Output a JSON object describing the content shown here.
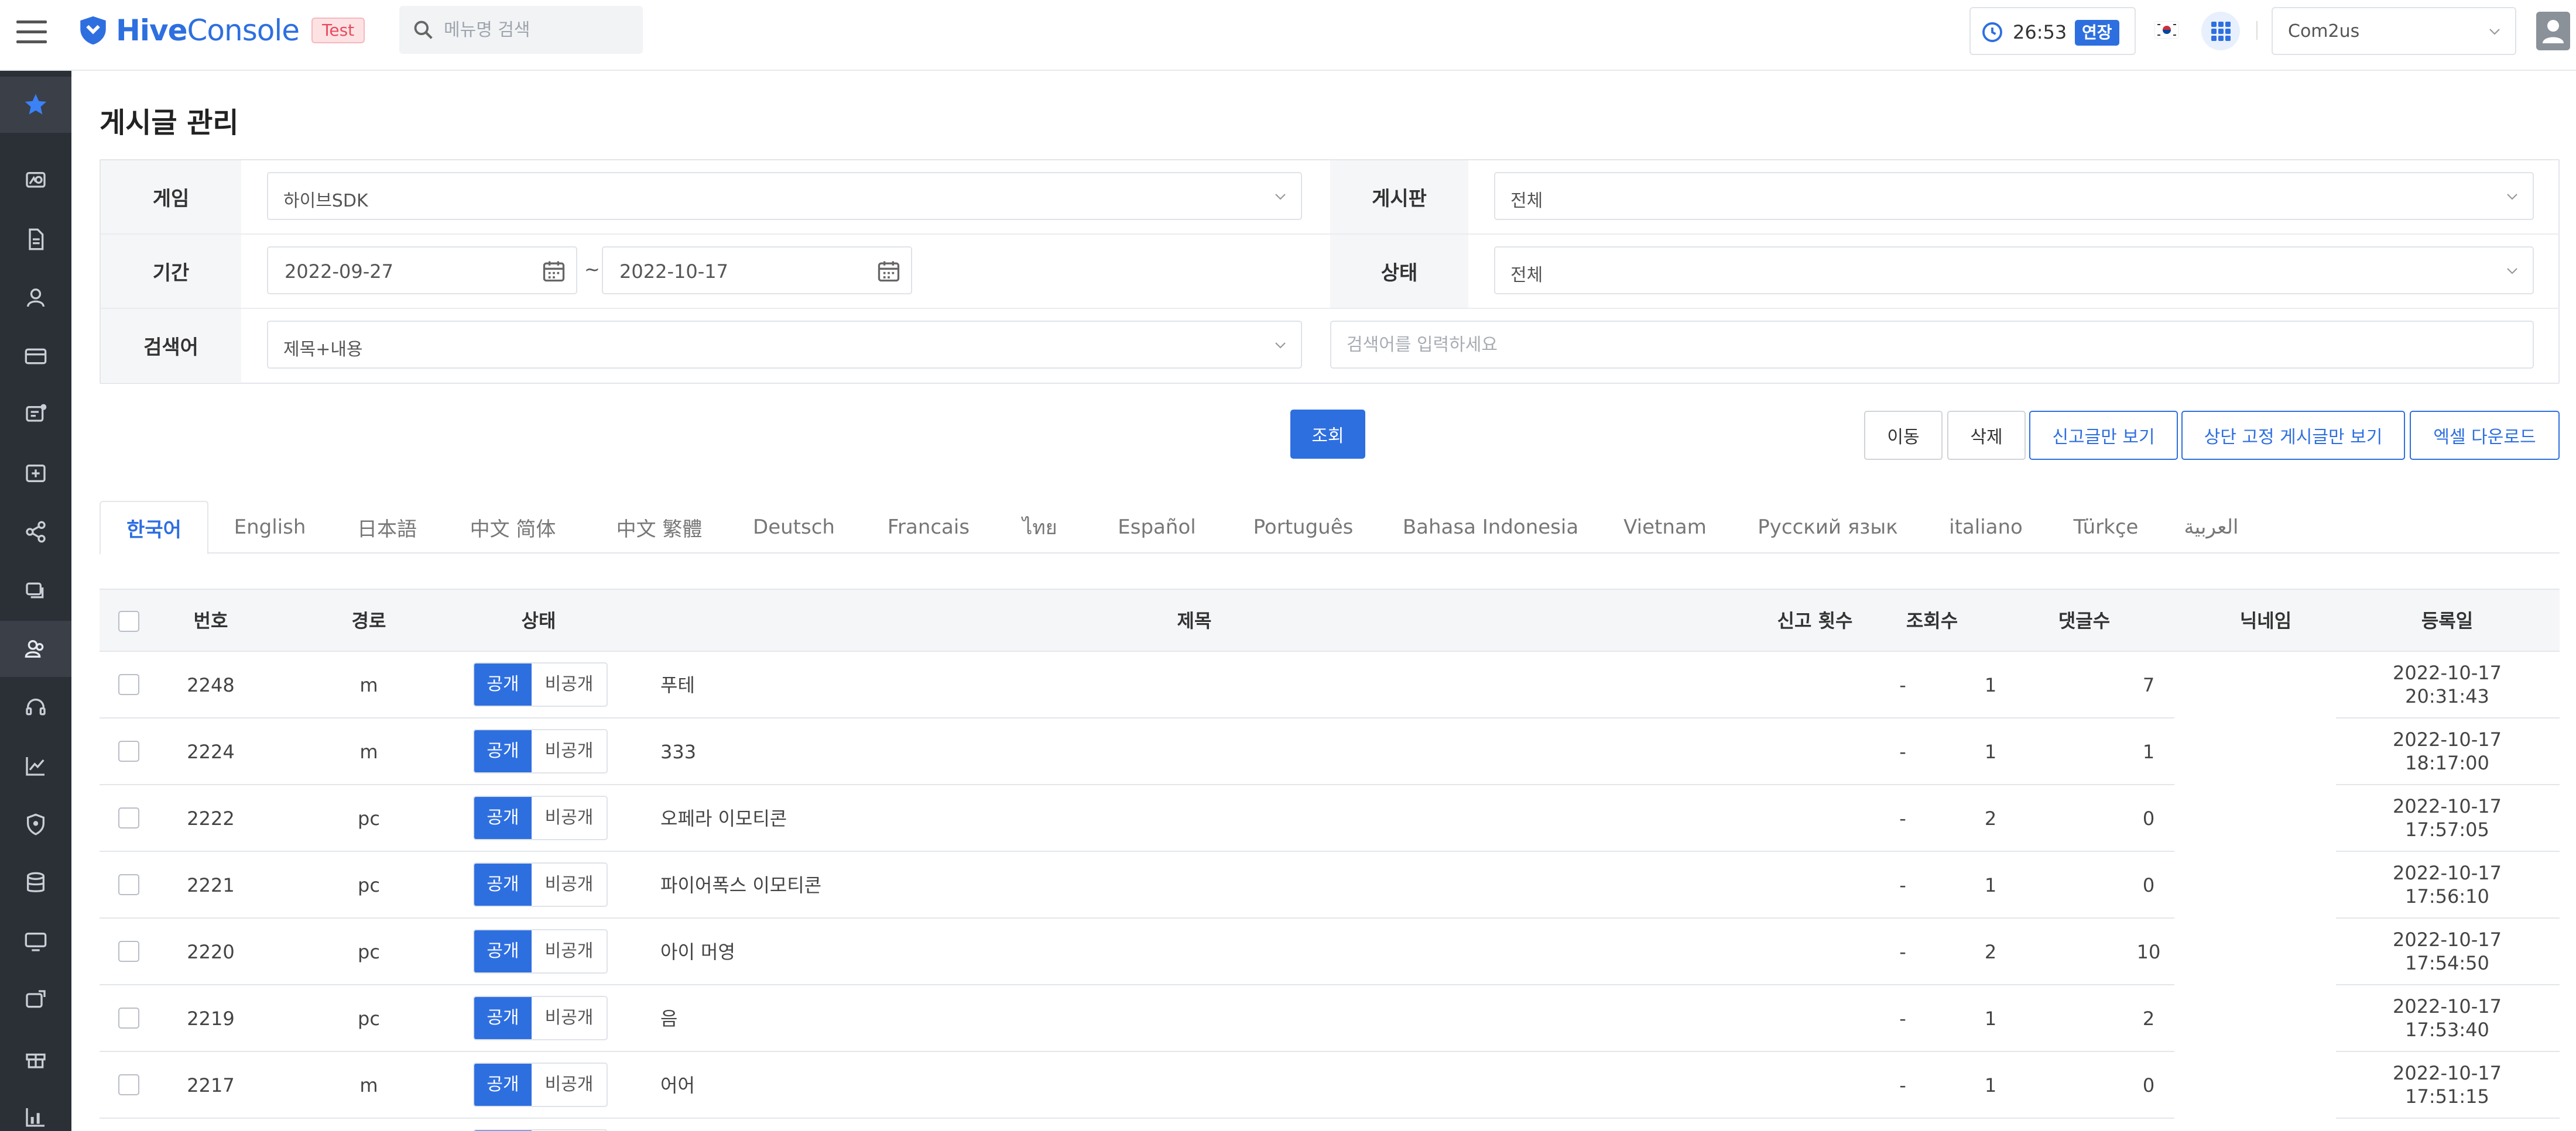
{
  "header": {
    "logo_bold": "Hive",
    "logo_light": "Console",
    "env_badge": "Test",
    "menu_search_placeholder": "메뉴명 검색",
    "timer": "26:53",
    "extend_label": "연장",
    "company": "Com2us"
  },
  "page": {
    "title": "게시글 관리"
  },
  "filters": {
    "game_label": "게임",
    "game_value": "하이브SDK",
    "board_label": "게시판",
    "board_value": "전체",
    "period_label": "기간",
    "date_from": "2022-09-27",
    "date_sep": "~",
    "date_to": "2022-10-17",
    "status_label": "상태",
    "status_value": "전체",
    "keyword_label": "검색어",
    "keyword_type": "제목+내용",
    "keyword_placeholder": "검색어를 입력하세요",
    "search_button": "조회"
  },
  "actions": {
    "move": "이동",
    "delete": "삭제",
    "reported_only": "신고글만 보기",
    "pinned_only": "상단 고정 게시글만 보기",
    "excel": "엑셀 다운로드"
  },
  "tabs": [
    "한국어",
    "English",
    "日本語",
    "中文 简体",
    "中文 繁體",
    "Deutsch",
    "Francais",
    "ไทย",
    "Español",
    "Português",
    "Bahasa Indonesia",
    "Vietnam",
    "Русский язык",
    "italiano",
    "Türkçe",
    "العربية"
  ],
  "table": {
    "headers": {
      "number": "번호",
      "route": "경로",
      "status": "상태",
      "title": "제목",
      "reports": "신고 횟수",
      "views": "조회수",
      "comments": "댓글수",
      "nickname": "닉네임",
      "registered": "등록일"
    },
    "toggle_on": "공개",
    "toggle_off": "비공개",
    "rows": [
      {
        "no": "2248",
        "route": "m",
        "title": "푸테",
        "reports": "-",
        "views": "1",
        "comments": "7",
        "date": "2022-10-17",
        "time": "20:31:43"
      },
      {
        "no": "2224",
        "route": "m",
        "title": "333",
        "reports": "-",
        "views": "1",
        "comments": "1",
        "date": "2022-10-17",
        "time": "18:17:00"
      },
      {
        "no": "2222",
        "route": "pc",
        "title": "오페라 이모티콘",
        "reports": "-",
        "views": "2",
        "comments": "0",
        "date": "2022-10-17",
        "time": "17:57:05"
      },
      {
        "no": "2221",
        "route": "pc",
        "title": "파이어폭스 이모티콘",
        "reports": "-",
        "views": "1",
        "comments": "0",
        "date": "2022-10-17",
        "time": "17:56:10"
      },
      {
        "no": "2220",
        "route": "pc",
        "title": "아이 머영",
        "reports": "-",
        "views": "2",
        "comments": "10",
        "date": "2022-10-17",
        "time": "17:54:50"
      },
      {
        "no": "2219",
        "route": "pc",
        "title": "음",
        "reports": "-",
        "views": "1",
        "comments": "2",
        "date": "2022-10-17",
        "time": "17:53:40"
      },
      {
        "no": "2217",
        "route": "m",
        "title": "어어",
        "reports": "-",
        "views": "1",
        "comments": "0",
        "date": "2022-10-17",
        "time": "17:51:15"
      }
    ]
  },
  "colors": {
    "primary": "#2e6fe0",
    "sidebar": "#2b2f36",
    "badge_bg": "#fde2e4"
  },
  "sidebar_icons": [
    "star-icon",
    "dashboard-icon",
    "document-icon",
    "user-icon",
    "card-icon",
    "message-icon",
    "add-box-icon",
    "share-icon",
    "chat-icon",
    "community-icon",
    "headset-icon",
    "chart-icon",
    "shield-icon",
    "database-icon",
    "monitor-icon",
    "sync-icon",
    "gift-icon",
    "stats-icon"
  ]
}
